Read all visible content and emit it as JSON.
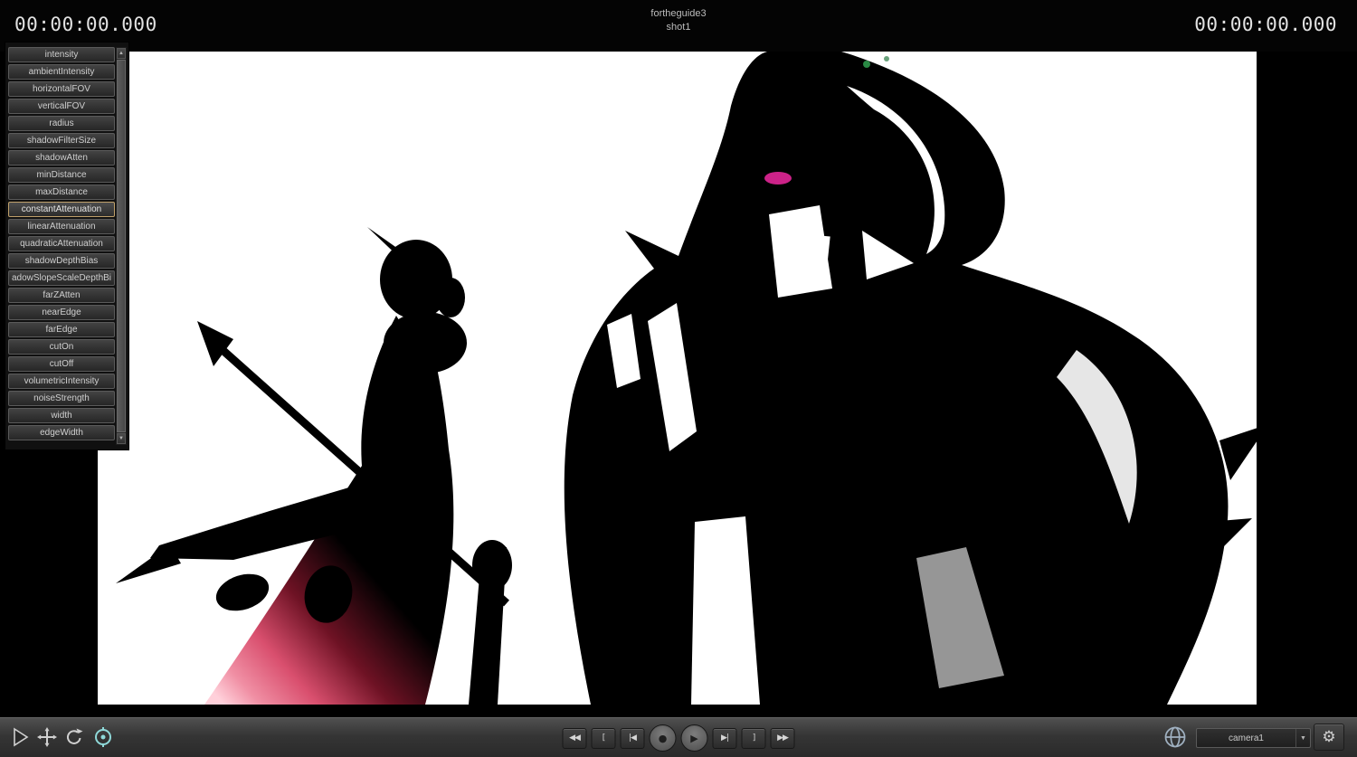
{
  "header": {
    "timecode_left": "00:00:00.000",
    "timecode_right": "00:00:00.000",
    "title": "fortheguide3",
    "subtitle": "shot1"
  },
  "parameter_panel": {
    "selected_item": "constantAttenuation",
    "items": [
      "intensity",
      "ambientIntensity",
      "horizontalFOV",
      "verticalFOV",
      "radius",
      "shadowFilterSize",
      "shadowAtten",
      "minDistance",
      "maxDistance",
      "constantAttenuation",
      "linearAttenuation",
      "quadraticAttenuation",
      "shadowDepthBias",
      "adowSlopeScaleDepthBi",
      "farZAtten",
      "nearEdge",
      "farEdge",
      "cutOn",
      "cutOff",
      "volumetricIntensity",
      "noiseStrength",
      "width",
      "edgeWidth"
    ],
    "scroll_up_glyph": "▲",
    "scroll_down_glyph": "▼"
  },
  "tools": {
    "items": [
      {
        "name": "select-tool",
        "icon": "cursor-arrow-icon",
        "active": false
      },
      {
        "name": "move-tool",
        "icon": "move-arrows-icon",
        "active": false
      },
      {
        "name": "rotate-tool",
        "icon": "rotate-arrows-icon",
        "active": false
      },
      {
        "name": "orbit-tool",
        "icon": "orbit-target-icon",
        "active": true
      }
    ],
    "active_tool_color": "#8fd9d9"
  },
  "transport": {
    "buttons": [
      {
        "name": "rewind-button",
        "glyph": "◀◀",
        "shape": "square"
      },
      {
        "name": "loop-in-button",
        "glyph": "[",
        "shape": "square"
      },
      {
        "name": "go-to-start-button",
        "glyph": "|◀",
        "shape": "square"
      },
      {
        "name": "record-button",
        "glyph": "●",
        "shape": "round"
      },
      {
        "name": "play-button",
        "glyph": "▶",
        "shape": "round"
      },
      {
        "name": "go-to-end-button",
        "glyph": "▶|",
        "shape": "square"
      },
      {
        "name": "loop-out-button",
        "glyph": "]",
        "shape": "square"
      },
      {
        "name": "fast-forward-button",
        "glyph": "▶▶",
        "shape": "square"
      }
    ]
  },
  "footer": {
    "camera_select_value": "camera1",
    "dropdown_glyph": "▼",
    "gear_glyph": "⚙"
  },
  "viewport": {
    "scene": "two backlit character silhouettes on blown-out white render",
    "colors": {
      "background_white": "#ffffff",
      "silhouette_black": "#000000",
      "cloak_pink": "#e2556f",
      "cloak_deep_red": "#7a1428",
      "eye_magenta": "#cc2288",
      "glint_green": "#33aa55"
    }
  }
}
